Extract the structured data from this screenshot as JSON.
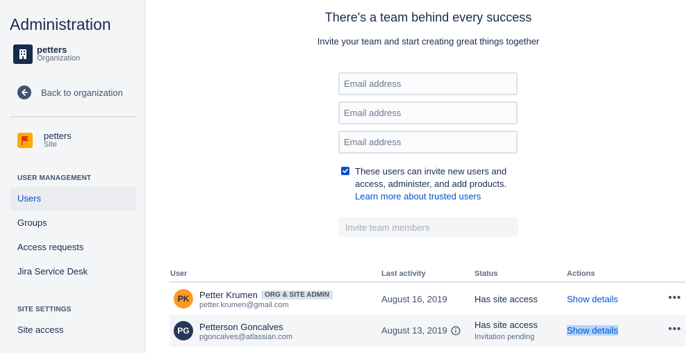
{
  "sidebar": {
    "title": "Administration",
    "org": {
      "name": "petters",
      "type": "Organization"
    },
    "back_label": "Back to organization",
    "site": {
      "name": "petters",
      "type": "Site"
    },
    "user_management_header": "USER MANAGEMENT",
    "user_management_items": [
      {
        "label": "Users",
        "active": true
      },
      {
        "label": "Groups"
      },
      {
        "label": "Access requests"
      },
      {
        "label": "Jira Service Desk"
      }
    ],
    "site_settings_header": "SITE SETTINGS",
    "site_settings_items": [
      {
        "label": "Site access"
      }
    ]
  },
  "invite": {
    "title": "There's a team behind every success",
    "subtitle": "Invite your team and start creating great things together",
    "email_placeholder": "Email address",
    "trusted_text": "These users can invite new users and access, administer, and add products.",
    "trusted_checked": true,
    "learn_more": "Learn more about trusted users",
    "invite_button": "Invite team members"
  },
  "table": {
    "headers": {
      "user": "User",
      "last_activity": "Last activity",
      "status": "Status",
      "actions": "Actions"
    },
    "rows": [
      {
        "initials": "PK",
        "avatar_color": "#FF991F",
        "name": "Petter Krumen",
        "badge": "ORG & SITE ADMIN",
        "email": "petter.krumen@gmail.com",
        "last_activity": "August 16, 2019",
        "status": "Has site access",
        "status_sub": "",
        "action": "Show details"
      },
      {
        "initials": "PG",
        "avatar_color": "#253858",
        "name": "Petterson Goncalves",
        "email": "pgoncalves@atlassian.com",
        "last_activity": "August 13, 2019",
        "status": "Has site access",
        "status_sub": "Invitation pending",
        "action": "Show details"
      }
    ]
  },
  "colors": {
    "accent": "#0052CC",
    "text": "#172B4D",
    "sidebar_bg": "#F4F5F7"
  }
}
